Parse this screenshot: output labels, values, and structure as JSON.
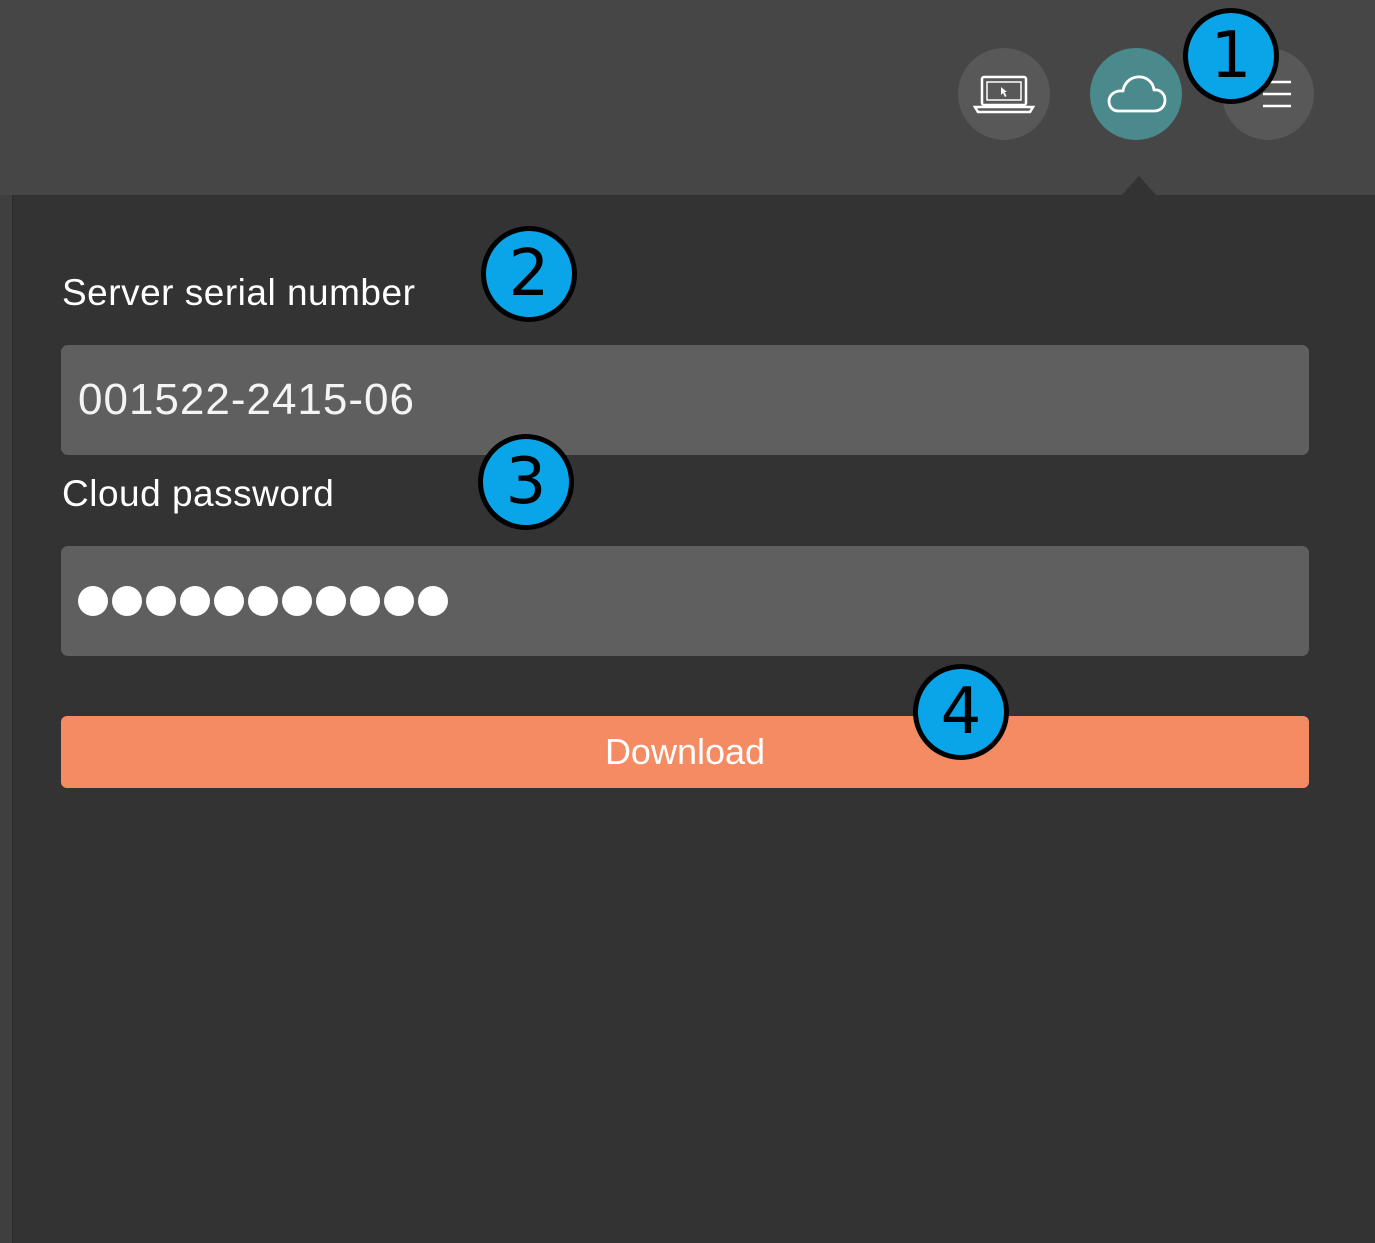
{
  "toolbar": {
    "buttons": [
      {
        "name": "desktop",
        "icon": "laptop-icon",
        "active": false
      },
      {
        "name": "cloud",
        "icon": "cloud-icon",
        "active": true
      },
      {
        "name": "list",
        "icon": "list-icon",
        "active": false
      }
    ]
  },
  "form": {
    "serial_label": "Server serial number",
    "serial_value": "001522-2415-06",
    "password_label": "Cloud password",
    "password_dot_count": 11,
    "download_label": "Download"
  },
  "callouts": [
    "1",
    "2",
    "3",
    "4"
  ],
  "colors": {
    "accent": "#f58b62",
    "active_nav": "#4a8a8c",
    "callout": "#0aa5e8"
  }
}
